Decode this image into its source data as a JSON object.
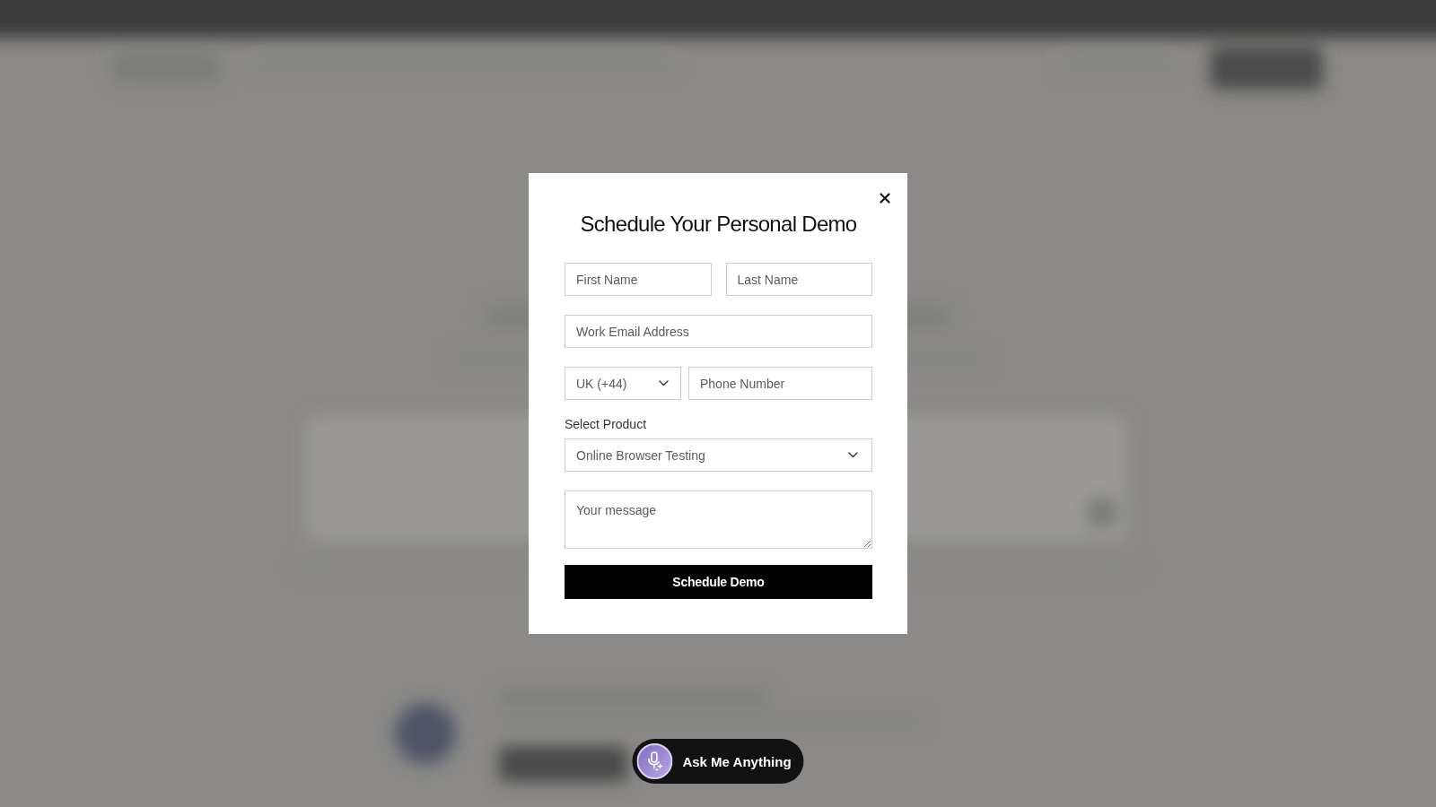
{
  "dialog": {
    "title": "Schedule Your Personal Demo",
    "rows": [
      {
        "fields": [
          {
            "kind": "input",
            "placeholder": "First Name"
          },
          {
            "kind": "input",
            "placeholder": "Last Name"
          }
        ]
      },
      {
        "fields": [
          {
            "kind": "input",
            "placeholder": "Work Email Address"
          }
        ]
      },
      {
        "fields": [
          {
            "kind": "select",
            "value": "UK (+44)"
          },
          {
            "kind": "input",
            "placeholder": "Phone Number"
          }
        ]
      }
    ],
    "product": {
      "label": "Select Product",
      "value": "Online Browser Testing"
    },
    "message": {
      "placeholder": "Your message"
    },
    "submit": "Schedule Demo"
  },
  "assistant_button": {
    "label": "Ask Me Anything"
  }
}
